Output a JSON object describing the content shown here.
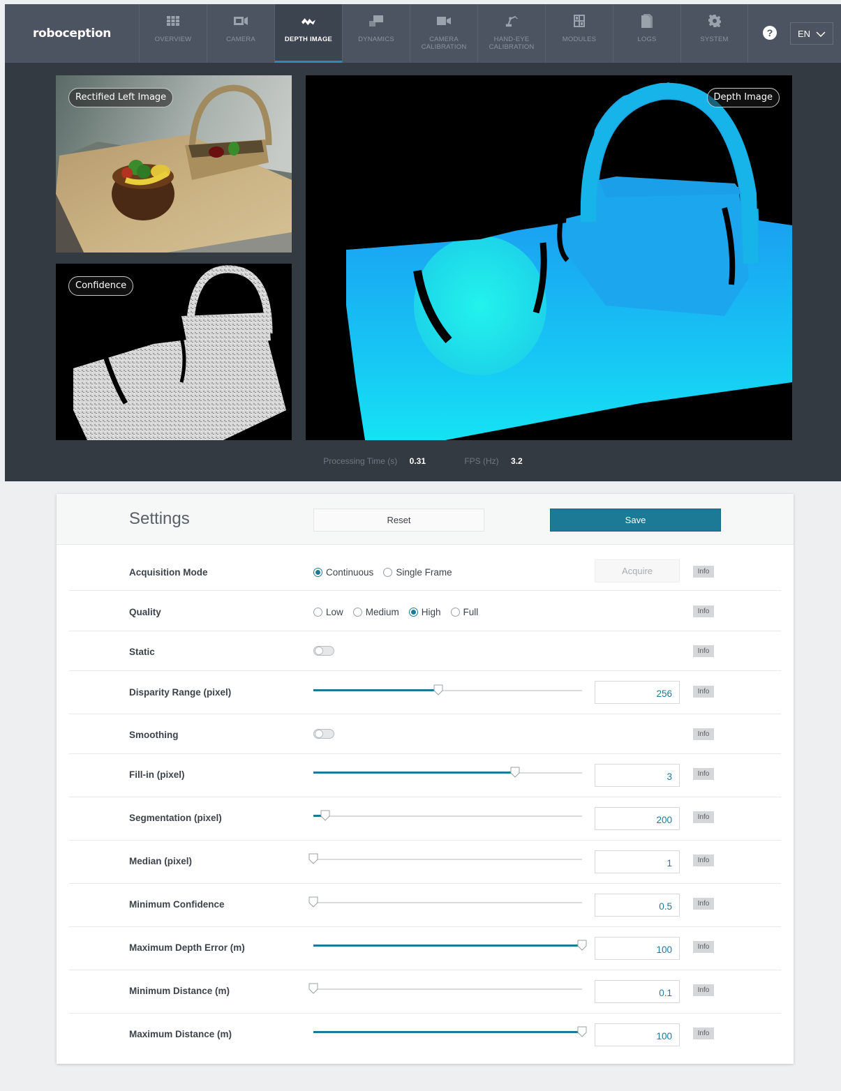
{
  "brand": "roboception",
  "nav": [
    {
      "label": "OVERVIEW",
      "icon": "grid-icon"
    },
    {
      "label": "CAMERA",
      "icon": "camera-icon"
    },
    {
      "label": "DEPTH IMAGE",
      "icon": "depth-icon"
    },
    {
      "label": "DYNAMICS",
      "icon": "dynamics-icon"
    },
    {
      "label": "CAMERA CALIBRATION",
      "icon": "video-camera-icon"
    },
    {
      "label": "HAND-EYE CALIBRATION",
      "icon": "robot-arm-icon"
    },
    {
      "label": "MODULES",
      "icon": "modules-icon"
    },
    {
      "label": "LOGS",
      "icon": "document-icon"
    },
    {
      "label": "SYSTEM",
      "icon": "gear-icon"
    }
  ],
  "active_nav": "DEPTH IMAGE",
  "help_glyph": "?",
  "language": "EN",
  "panels": {
    "left_image": "Rectified Left Image",
    "confidence": "Confidence",
    "depth": "Depth Image"
  },
  "stats": {
    "processing_label": "Processing Time (s)",
    "processing_value": "0.31",
    "fps_label": "FPS (Hz)",
    "fps_value": "3.2"
  },
  "settings": {
    "title": "Settings",
    "reset_label": "Reset",
    "save_label": "Save",
    "info_label": "Info",
    "acquire_label": "Acquire",
    "acquisition_mode": {
      "label": "Acquisition Mode",
      "options": [
        "Continuous",
        "Single Frame"
      ],
      "selected": "Continuous"
    },
    "quality": {
      "label": "Quality",
      "options": [
        "Low",
        "Medium",
        "High",
        "Full"
      ],
      "selected": "High"
    },
    "static": {
      "label": "Static",
      "enabled": false
    },
    "smoothing": {
      "label": "Smoothing",
      "enabled": false
    },
    "sliders": [
      {
        "label": "Disparity Range (pixel)",
        "value": "256",
        "fraction": 0.465
      },
      {
        "label": "Fill-in (pixel)",
        "value": "3",
        "fraction": 0.75
      },
      {
        "label": "Segmentation (pixel)",
        "value": "200",
        "fraction": 0.045
      },
      {
        "label": "Median (pixel)",
        "value": "1",
        "fraction": 0.0
      },
      {
        "label": "Minimum Confidence",
        "value": "0.5",
        "fraction": 0.0
      },
      {
        "label": "Maximum Depth Error (m)",
        "value": "100",
        "fraction": 1.0
      },
      {
        "label": "Minimum Distance (m)",
        "value": "0.1",
        "fraction": 0.0
      },
      {
        "label": "Maximum Distance (m)",
        "value": "100",
        "fraction": 1.0
      }
    ]
  },
  "colors": {
    "accent": "#1d7a96",
    "nav_bg": "#4b5460",
    "view_bg": "#333a42",
    "depth_cyan": "#1ad4f0"
  }
}
